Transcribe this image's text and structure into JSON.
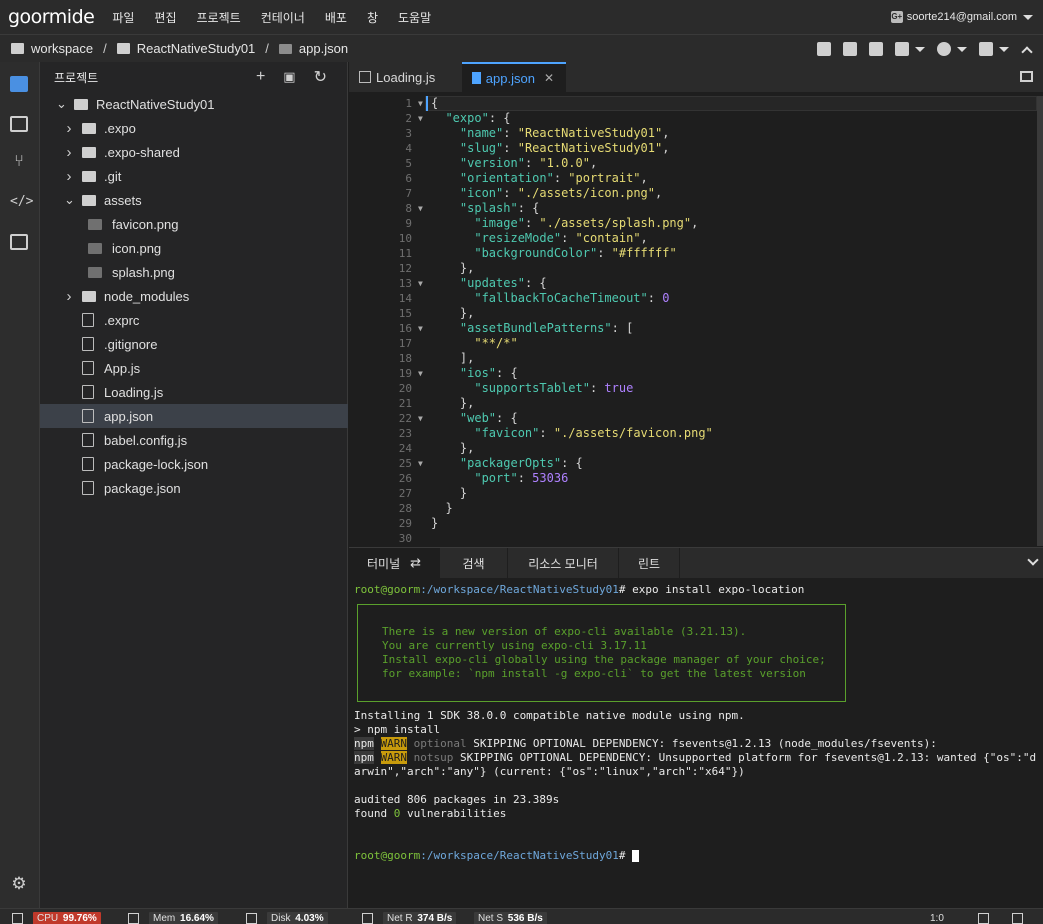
{
  "brand": "goormide",
  "menu": [
    "파일",
    "편집",
    "프로젝트",
    "컨테이너",
    "배포",
    "창",
    "도움말"
  ],
  "account": {
    "email": "soorte214@gmail.com",
    "badge": "G+"
  },
  "breadcrumb": [
    "workspace",
    "ReactNativeStudy01",
    "app.json"
  ],
  "toolbar_icons": [
    "save-icon",
    "save-all-icon",
    "search-replace-icon",
    "wrench-icon",
    "run-icon",
    "flask-icon",
    "chevron-up-icon"
  ],
  "sidebar": {
    "title": "프로젝트",
    "tree": [
      {
        "label": "ReactNativeStudy01",
        "type": "folder",
        "open": true,
        "depth": 0
      },
      {
        "label": ".expo",
        "type": "folder",
        "open": false,
        "depth": 1
      },
      {
        "label": ".expo-shared",
        "type": "folder",
        "open": false,
        "depth": 1
      },
      {
        "label": ".git",
        "type": "folder",
        "open": false,
        "depth": 1
      },
      {
        "label": "assets",
        "type": "folder",
        "open": true,
        "depth": 1
      },
      {
        "label": "favicon.png",
        "type": "png",
        "depth": 2
      },
      {
        "label": "icon.png",
        "type": "png",
        "depth": 2
      },
      {
        "label": "splash.png",
        "type": "png",
        "depth": 2
      },
      {
        "label": "node_modules",
        "type": "folder",
        "open": false,
        "depth": 1
      },
      {
        "label": ".exprc",
        "type": "file",
        "depth": 1
      },
      {
        "label": ".gitignore",
        "type": "file",
        "depth": 1
      },
      {
        "label": "App.js",
        "type": "js",
        "depth": 1
      },
      {
        "label": "Loading.js",
        "type": "js",
        "depth": 1
      },
      {
        "label": "app.json",
        "type": "json",
        "depth": 1,
        "selected": true
      },
      {
        "label": "babel.config.js",
        "type": "js",
        "depth": 1
      },
      {
        "label": "package-lock.json",
        "type": "json",
        "depth": 1
      },
      {
        "label": "package.json",
        "type": "json",
        "depth": 1
      }
    ]
  },
  "editor": {
    "tabs": [
      {
        "label": "Loading.js",
        "active": false
      },
      {
        "label": "app.json",
        "active": true
      }
    ],
    "lines": [
      "{",
      "  \"expo\": {",
      "    \"name\": \"ReactNativeStudy01\",",
      "    \"slug\": \"ReactNativeStudy01\",",
      "    \"version\": \"1.0.0\",",
      "    \"orientation\": \"portrait\",",
      "    \"icon\": \"./assets/icon.png\",",
      "    \"splash\": {",
      "      \"image\": \"./assets/splash.png\",",
      "      \"resizeMode\": \"contain\",",
      "      \"backgroundColor\": \"#ffffff\"",
      "    },",
      "    \"updates\": {",
      "      \"fallbackToCacheTimeout\": 0",
      "    },",
      "    \"assetBundlePatterns\": [",
      "      \"**/*\"",
      "    ],",
      "    \"ios\": {",
      "      \"supportsTablet\": true",
      "    },",
      "    \"web\": {",
      "      \"favicon\": \"./assets/favicon.png\"",
      "    },",
      "    \"packagerOpts\": {",
      "      \"port\": 53036",
      "    }",
      "  }",
      "}",
      ""
    ],
    "fold_lines": [
      1,
      2,
      8,
      13,
      16,
      19,
      22,
      25
    ]
  },
  "panel": {
    "tabs": [
      "터미널",
      "검색",
      "리소스 모니터",
      "린트"
    ],
    "terminal": {
      "prompt_user": "root@goorm",
      "prompt_path": ":/workspace/ReactNativeStudy01",
      "prompt_symbol": "#",
      "command": " expo install expo-location",
      "box": [
        "There is a new version of expo-cli available (3.21.13).",
        "You are currently using expo-cli 3.17.11",
        "Install expo-cli globally using the package manager of your choice;",
        "for example: `npm install -g expo-cli` to get the latest version"
      ],
      "install_line": "Installing 1 SDK 38.0.0 compatible native module using npm.",
      "npm_install": "> npm install",
      "warn1": {
        "npm": "npm",
        "tag": "WARN",
        "kind": "optional",
        "text": " SKIPPING OPTIONAL DEPENDENCY: fsevents@1.2.13 (node_modules/fsevents):"
      },
      "warn2": {
        "npm": "npm",
        "tag": "WARN",
        "kind": "notsup",
        "text": " SKIPPING OPTIONAL DEPENDENCY: Unsupported platform for fsevents@1.2.13: wanted {\"os\":\"d"
      },
      "warn2_cont": "arwin\",\"arch\":\"any\"} (current: {\"os\":\"linux\",\"arch\":\"x64\"})",
      "audited": "audited 806 packages in 23.389s",
      "found_prefix": "found ",
      "found_count": "0",
      "found_suffix": " vulnerabilities"
    }
  },
  "status": {
    "cpu_label": "CPU",
    "cpu_value": "99.76%",
    "cpu_color": "#c0392b",
    "mem_label": "Mem",
    "mem_value": "16.64%",
    "disk_label": "Disk",
    "disk_value": "4.03%",
    "netr_label": "Net R",
    "netr_value": "374 B/s",
    "nets_label": "Net S",
    "nets_value": "536 B/s",
    "cursor_pos": "1:0"
  },
  "colors": {
    "accent": "#4ea4ff",
    "background": "#1e1e1e",
    "terminal_green": "#7ec33b",
    "warn": "#c89b0c"
  }
}
